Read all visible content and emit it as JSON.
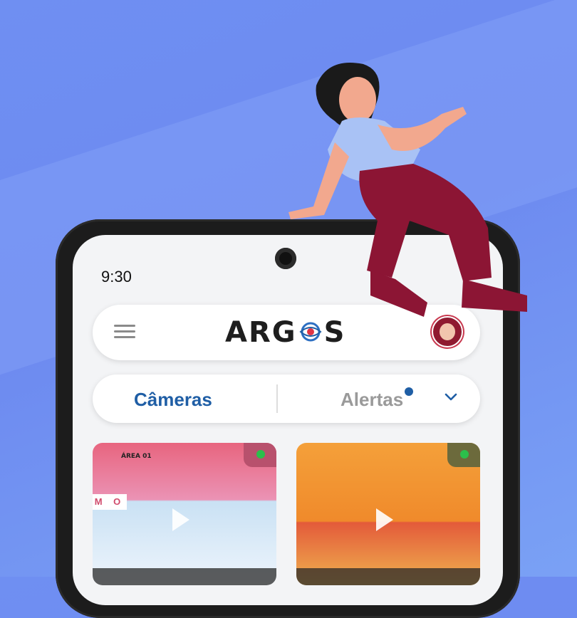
{
  "status_bar": {
    "time": "9:30"
  },
  "app": {
    "logo_text_left": "ARG",
    "logo_text_right": "S",
    "logo_icon": "eye-icon"
  },
  "tabs": {
    "cameras": "Câmeras",
    "alerts": "Alertas",
    "alerts_has_notification": true,
    "chevron_icon": "chevron-down-icon"
  },
  "cards": [
    {
      "area_label": "ÁREA 01",
      "sign_text": "M O",
      "status": "online",
      "status_color": "#2bbf4b"
    },
    {
      "status": "online",
      "status_color": "#2bbf4b"
    }
  ],
  "colors": {
    "accent": "#1f5ea5",
    "background": "#6f8ff2",
    "online": "#2bbf4b"
  }
}
